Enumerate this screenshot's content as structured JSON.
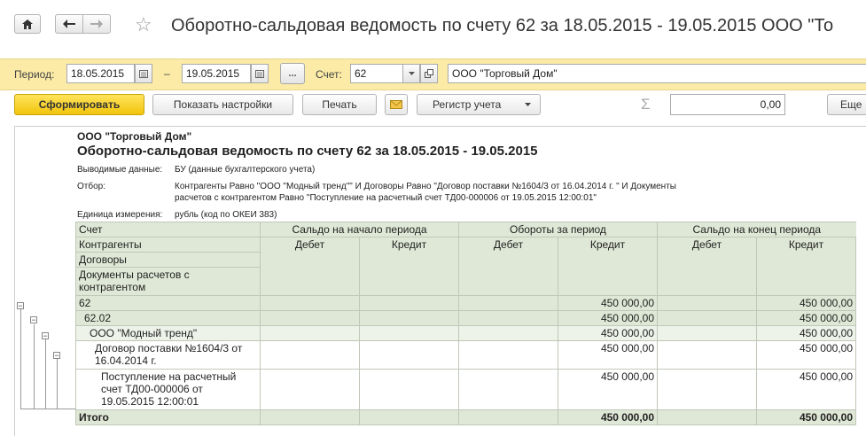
{
  "window": {
    "title": "Оборотно-сальдовая ведомость по счету 62 за 18.05.2015 - 19.05.2015 ООО \"То"
  },
  "nav": {
    "home_icon": "home-icon",
    "back_icon": "arrow-left-icon",
    "forward_icon": "arrow-right-icon",
    "favorite_icon": "star-icon"
  },
  "filter": {
    "period_label": "Период:",
    "date_from": "18.05.2015",
    "dash": "–",
    "date_to": "19.05.2015",
    "ellipsis": "...",
    "account_label": "Счет:",
    "account_value": "62",
    "organization": "ООО \"Торговый Дом\""
  },
  "toolbar": {
    "generate_label": "Сформировать",
    "settings_label": "Показать настройки",
    "print_label": "Печать",
    "register_label": "Регистр учета",
    "sum_symbol": "Σ",
    "sum_value": "0,00",
    "more_label": "Еще"
  },
  "report": {
    "org_name": "ООО \"Торговый Дом\"",
    "heading": "Оборотно-сальдовая ведомость по счету 62 за 18.05.2015 - 19.05.2015",
    "output_label": "Выводимые данные:",
    "output_value": "БУ (данные бухгалтерского учета)",
    "selection_label": "Отбор:",
    "selection_line1": "Контрагенты Равно \"ООО \"Модный тренд\"\" И Договоры Равно \"Договор поставки №1604/3 от 16.04.2014 г. \" И Документы",
    "selection_line2": "расчетов с контрагентом Равно \"Поступление на расчетный счет ТД00-000006 от 19.05.2015 12:00:01\"",
    "unit_label": "Единица измерения:",
    "unit_value": "рубль (код по ОКЕИ 383)"
  },
  "table": {
    "headers": {
      "account": "Счет",
      "counterparties": "Контрагенты",
      "contracts": "Договоры",
      "documents": "Документы расчетов с контрагентом",
      "opening": "Сальдо на начало периода",
      "turnover": "Обороты за период",
      "closing": "Сальдо на конец периода",
      "debit": "Дебет",
      "credit": "Кредит"
    },
    "rows": [
      {
        "name": "62",
        "turn_credit": "450 000,00",
        "close_credit": "450 000,00"
      },
      {
        "name": "62.02",
        "turn_credit": "450 000,00",
        "close_credit": "450 000,00"
      },
      {
        "name": "ООО \"Модный тренд\"",
        "turn_credit": "450 000,00",
        "close_credit": "450 000,00"
      },
      {
        "name": "Договор поставки №1604/3 от 16.04.2014 г.",
        "turn_credit": "450 000,00",
        "close_credit": "450 000,00"
      },
      {
        "name": "Поступление на расчетный счет ТД00-000006 от 19.05.2015 12:00:01",
        "turn_credit": "450 000,00",
        "close_credit": "450 000,00"
      }
    ],
    "total": {
      "name": "Итого",
      "turn_credit": "450 000,00",
      "close_credit": "450 000,00"
    }
  }
}
